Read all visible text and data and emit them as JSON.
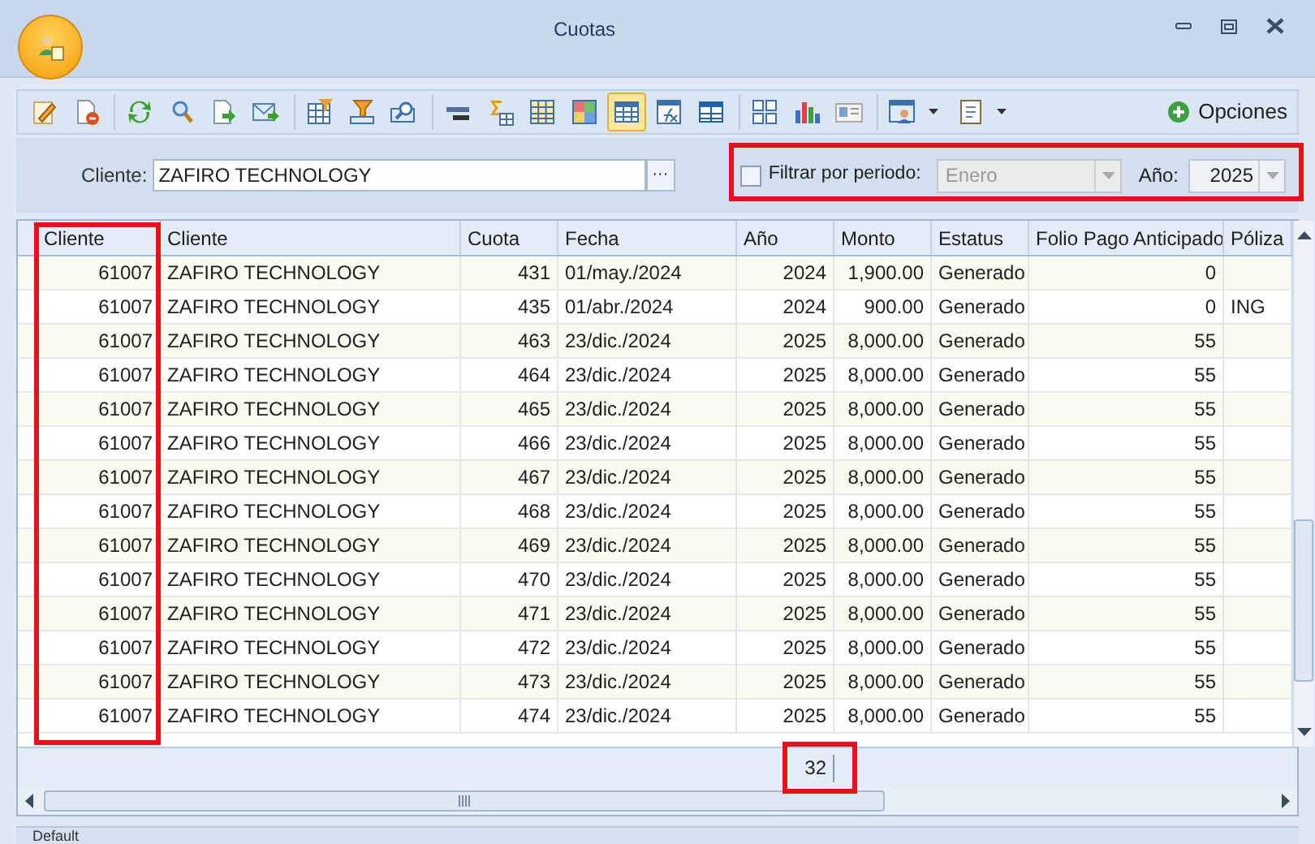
{
  "window": {
    "title": "Cuotas"
  },
  "toolbar": {
    "buttons": [
      {
        "selected": false
      },
      {
        "selected": false
      },
      {
        "selected": false
      },
      {
        "selected": false
      },
      {
        "selected": false
      },
      {
        "selected": false
      },
      {
        "selected": false
      },
      {
        "selected": false
      },
      {
        "selected": false
      },
      {
        "selected": false
      },
      {
        "selected": false
      },
      {
        "selected": false
      },
      {
        "selected": false
      },
      {
        "selected": true
      },
      {
        "selected": false
      },
      {
        "selected": false
      },
      {
        "selected": false
      },
      {
        "selected": false
      },
      {
        "selected": false
      },
      {
        "selected": false
      },
      {
        "selected": false
      }
    ],
    "options_button": "Opciones"
  },
  "filter": {
    "client_label": "Cliente:",
    "client_value": "ZAFIRO TECHNOLOGY",
    "browse_button": "···",
    "period_filter": {
      "label": "Filtrar por periodo:",
      "checked": false
    },
    "month": {
      "value": "Enero",
      "disabled": true
    },
    "year_label": "Año:",
    "year_value": "2025"
  },
  "table": {
    "columns": [
      "Cliente",
      "Cliente",
      "Cuota",
      "Fecha",
      "Año",
      "Monto",
      "Estatus",
      "Folio Pago Anticipado",
      "Póliza"
    ],
    "rows": [
      {
        "cliente_id": "61007",
        "cliente": "ZAFIRO TECHNOLOGY",
        "cuota": "431",
        "fecha": "01/may./2024",
        "anio": "2024",
        "monto": "1,900.00",
        "estatus": "Generado",
        "folio": "0"
      },
      {
        "cliente_id": "61007",
        "cliente": "ZAFIRO TECHNOLOGY",
        "cuota": "435",
        "fecha": "01/abr./2024",
        "anio": "2024",
        "monto": "900.00",
        "estatus": "Generado",
        "folio": "0",
        "poliza": "ING"
      },
      {
        "cliente_id": "61007",
        "cliente": "ZAFIRO TECHNOLOGY",
        "cuota": "463",
        "fecha": "23/dic./2024",
        "anio": "2025",
        "monto": "8,000.00",
        "estatus": "Generado",
        "folio": "55"
      },
      {
        "cliente_id": "61007",
        "cliente": "ZAFIRO TECHNOLOGY",
        "cuota": "464",
        "fecha": "23/dic./2024",
        "anio": "2025",
        "monto": "8,000.00",
        "estatus": "Generado",
        "folio": "55"
      },
      {
        "cliente_id": "61007",
        "cliente": "ZAFIRO TECHNOLOGY",
        "cuota": "465",
        "fecha": "23/dic./2024",
        "anio": "2025",
        "monto": "8,000.00",
        "estatus": "Generado",
        "folio": "55"
      },
      {
        "cliente_id": "61007",
        "cliente": "ZAFIRO TECHNOLOGY",
        "cuota": "466",
        "fecha": "23/dic./2024",
        "anio": "2025",
        "monto": "8,000.00",
        "estatus": "Generado",
        "folio": "55"
      },
      {
        "cliente_id": "61007",
        "cliente": "ZAFIRO TECHNOLOGY",
        "cuota": "467",
        "fecha": "23/dic./2024",
        "anio": "2025",
        "monto": "8,000.00",
        "estatus": "Generado",
        "folio": "55"
      },
      {
        "cliente_id": "61007",
        "cliente": "ZAFIRO TECHNOLOGY",
        "cuota": "468",
        "fecha": "23/dic./2024",
        "anio": "2025",
        "monto": "8,000.00",
        "estatus": "Generado",
        "folio": "55"
      },
      {
        "cliente_id": "61007",
        "cliente": "ZAFIRO TECHNOLOGY",
        "cuota": "469",
        "fecha": "23/dic./2024",
        "anio": "2025",
        "monto": "8,000.00",
        "estatus": "Generado",
        "folio": "55"
      },
      {
        "cliente_id": "61007",
        "cliente": "ZAFIRO TECHNOLOGY",
        "cuota": "470",
        "fecha": "23/dic./2024",
        "anio": "2025",
        "monto": "8,000.00",
        "estatus": "Generado",
        "folio": "55"
      },
      {
        "cliente_id": "61007",
        "cliente": "ZAFIRO TECHNOLOGY",
        "cuota": "471",
        "fecha": "23/dic./2024",
        "anio": "2025",
        "monto": "8,000.00",
        "estatus": "Generado",
        "folio": "55"
      },
      {
        "cliente_id": "61007",
        "cliente": "ZAFIRO TECHNOLOGY",
        "cuota": "472",
        "fecha": "23/dic./2024",
        "anio": "2025",
        "monto": "8,000.00",
        "estatus": "Generado",
        "folio": "55"
      },
      {
        "cliente_id": "61007",
        "cliente": "ZAFIRO TECHNOLOGY",
        "cuota": "473",
        "fecha": "23/dic./2024",
        "anio": "2025",
        "monto": "8,000.00",
        "estatus": "Generado",
        "folio": "55"
      },
      {
        "cliente_id": "61007",
        "cliente": "ZAFIRO TECHNOLOGY",
        "cuota": "474",
        "fecha": "23/dic./2024",
        "anio": "2025",
        "monto": "8,000.00",
        "estatus": "Generado",
        "folio": "55"
      }
    ],
    "footer": {
      "count": "32"
    }
  },
  "status_bar": "Default"
}
